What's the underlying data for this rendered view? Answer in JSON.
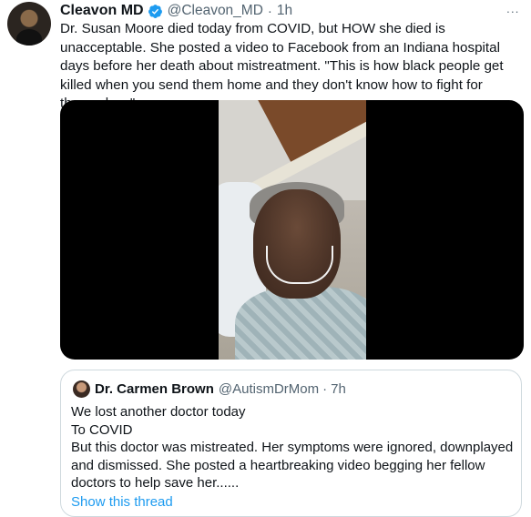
{
  "tweet": {
    "author_name": "Cleavon MD",
    "handle": "@Cleavon_MD",
    "separator": "·",
    "time": "1h",
    "more_label": "···",
    "text": "Dr. Susan Moore died today from COVID, but HOW she died is unacceptable. She posted a video to Facebook from an Indiana hospital days before her death about mistreatment. \"This is how black people get killed when you send them home and they don't know how to fight for themselves\"",
    "verified_icon": "verified-badge-icon",
    "colors": {
      "text": "#0f1419",
      "secondary": "#536471",
      "accent": "#1d9bf0",
      "border": "#cfd9de"
    }
  },
  "quoted": {
    "author_name": "Dr. Carmen Brown",
    "handle": "@AutismDrMom",
    "separator": "·",
    "time": "7h",
    "lines": [
      "We lost another doctor today",
      "To COVID",
      "But this doctor was mistreated. Her symptoms were ignored, downplayed and dismissed. She posted a heartbreaking video begging her fellow doctors to help save her......"
    ],
    "show_thread": "Show this thread"
  }
}
